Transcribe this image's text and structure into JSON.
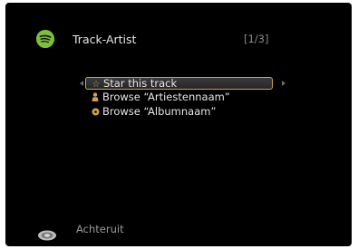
{
  "header": {
    "app_icon": "spotify-icon",
    "title": "Track-Artist",
    "page_indicator": "[1/3]"
  },
  "menu": {
    "items": [
      {
        "icon": "star-icon",
        "label": "Star this track",
        "selected": true
      },
      {
        "icon": "person-icon",
        "label": "Browse “Artiestennaam”",
        "selected": false
      },
      {
        "icon": "disc-icon",
        "label": "Browse “Albumnaam”",
        "selected": false
      }
    ]
  },
  "footer": {
    "icon": "back-button-icon",
    "label": "Achteruit"
  },
  "colors": {
    "background": "#000000",
    "accent": "#d2a24a",
    "spotify_green": "#7dbf3a",
    "text": "#e6e6e6",
    "muted_text": "#9a9a9a"
  }
}
